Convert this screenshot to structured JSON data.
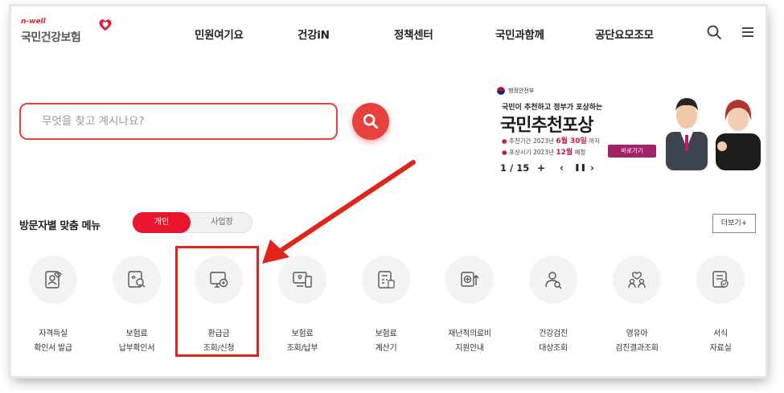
{
  "header": {
    "logo_small": "n-well",
    "logo_main": "국민건강보험",
    "nav": [
      "민원여기요",
      "건강iN",
      "정책센터",
      "국민과함께",
      "공단요모조모"
    ],
    "icons": [
      "search-icon",
      "menu-icon"
    ]
  },
  "search": {
    "placeholder": "무엇을 찾고 계시나요?",
    "button_icon": "search-icon",
    "accent": "#e8413c"
  },
  "banner": {
    "ministry": "행정안전부",
    "subtitle": "국민이 추천하고 정부가 포상하는",
    "title": "국민추천포상",
    "line1_prefix": "추천기간",
    "line1_text": "2023년 ",
    "line1_accent": "6월 30일",
    "line1_suffix": " 까지",
    "line2_prefix": "포상시기",
    "line2_text": "2023년 ",
    "line2_accent": "12월",
    "line2_suffix": " 예정",
    "go_button": "바로가기",
    "pager": "1 / 15",
    "controls": [
      "+",
      "‹",
      "❚❚",
      "›"
    ]
  },
  "section": {
    "title": "방문자별 맞춤 메뉴",
    "toggle_on": "개인",
    "toggle_off": "사업장",
    "more": "더보기+"
  },
  "menu": [
    {
      "line1": "자격득실",
      "line2": "확인서 발급",
      "icon": "id-card-heart-icon"
    },
    {
      "line1": "보험료",
      "line2": "납부확인서",
      "icon": "document-search-icon"
    },
    {
      "line1": "환급금",
      "line2": "조회/신청",
      "icon": "monitor-coin-icon"
    },
    {
      "line1": "보험료",
      "line2": "조회/납부",
      "icon": "monitor-heart-icon"
    },
    {
      "line1": "보험료",
      "line2": "계산기",
      "icon": "calculator-document-icon"
    },
    {
      "line1": "재난적의료비",
      "line2": "지원안내",
      "icon": "medical-support-icon"
    },
    {
      "line1": "건강검진",
      "line2": "대상조회",
      "icon": "person-search-icon"
    },
    {
      "line1": "영유아",
      "line2": "검진결과조회",
      "icon": "family-heart-icon"
    },
    {
      "line1": "서식",
      "line2": "자료실",
      "icon": "form-document-icon"
    }
  ],
  "colors": {
    "primary": "#e8152d",
    "highlight": "#e2231a"
  }
}
